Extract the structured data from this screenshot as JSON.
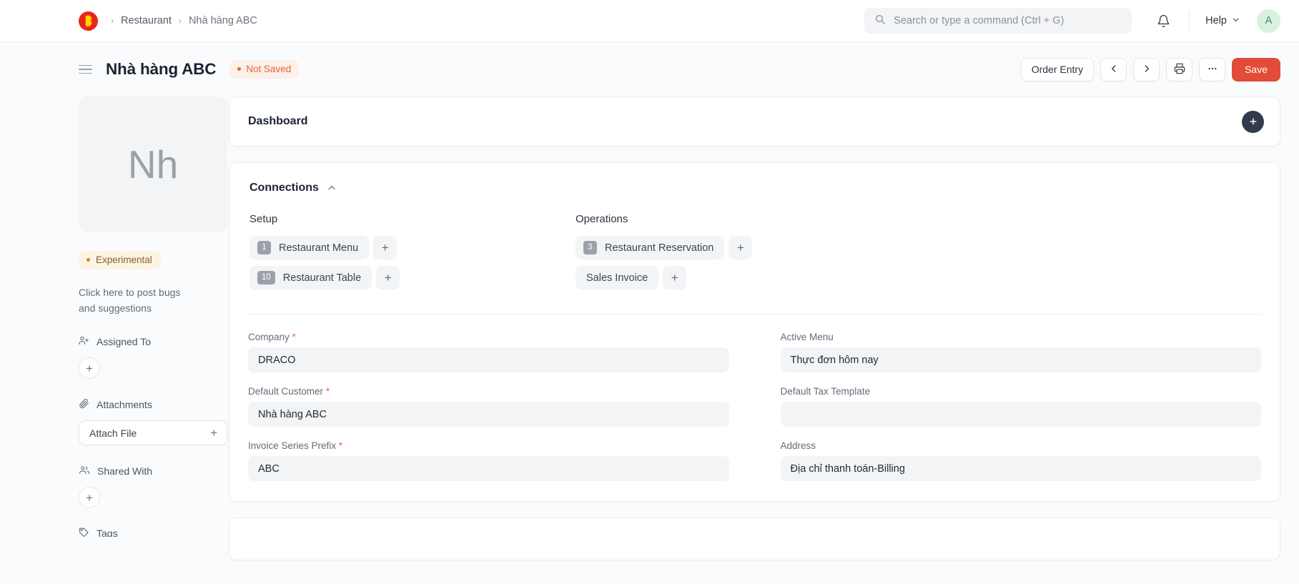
{
  "navbar": {
    "logo_icon": "draco-logo-icon",
    "breadcrumbs": [
      {
        "label": "Restaurant"
      },
      {
        "label": "Nhà hàng ABC"
      }
    ],
    "separator": "›",
    "search": {
      "icon": "search-icon",
      "placeholder": "Search or type a command (Ctrl + G)",
      "value": ""
    },
    "notifications_icon": "bell-icon",
    "help_label": "Help",
    "help_chevron": "chevron-down-icon",
    "avatar_initial": "A"
  },
  "page_head": {
    "menu_icon": "hamburger-icon",
    "title": "Nhà hàng ABC",
    "status_badge": "Not Saved",
    "actions": {
      "order_entry": "Order Entry",
      "prev_icon": "chevron-left-icon",
      "next_icon": "chevron-right-icon",
      "print_icon": "printer-icon",
      "more_icon": "ellipsis-icon",
      "more_label": "···",
      "save": "Save"
    }
  },
  "sidebar": {
    "avatar_text": "Nh",
    "experimental_badge": "Experimental",
    "note": "Click here to post bugs and suggestions",
    "sections": [
      {
        "label": "Assigned To",
        "icon": "user-plus-icon",
        "add_label": "+"
      },
      {
        "label": "Attachments",
        "icon": "paperclip-icon",
        "attach_label": "Attach File",
        "add_label": "+"
      },
      {
        "label": "Shared With",
        "icon": "users-icon",
        "add_label": "+"
      },
      {
        "label": "Tags",
        "icon": "tag-icon"
      }
    ]
  },
  "main": {
    "dashboard": {
      "title": "Dashboard",
      "add_icon": "plus-icon",
      "add_label": "+"
    },
    "connections": {
      "title": "Connections",
      "collapse_icon": "chevron-up-icon",
      "groups": [
        {
          "heading": "Setup",
          "items": [
            {
              "count": "1",
              "label": "Restaurant Menu",
              "add_label": "+"
            },
            {
              "count": "10",
              "label": "Restaurant Table",
              "add_label": "+"
            }
          ]
        },
        {
          "heading": "Operations",
          "items": [
            {
              "count": "3",
              "label": "Restaurant Reservation",
              "add_label": "+"
            },
            {
              "count": "",
              "label": "Sales Invoice",
              "add_label": "+"
            }
          ]
        }
      ]
    },
    "fields": {
      "left": [
        {
          "label": "Company",
          "required": true,
          "value": "DRACO",
          "placeholder": ""
        },
        {
          "label": "Default Customer",
          "required": true,
          "value": "Nhà hàng ABC",
          "placeholder": ""
        },
        {
          "label": "Invoice Series Prefix",
          "required": true,
          "value": "ABC",
          "placeholder": ""
        }
      ],
      "right": [
        {
          "label": "Active Menu",
          "required": false,
          "value": "Thực đơn hôm nay",
          "placeholder": ""
        },
        {
          "label": "Default Tax Template",
          "required": false,
          "value": "",
          "placeholder": ""
        },
        {
          "label": "Address",
          "required": false,
          "value": "Địa chỉ thanh toán-Billing",
          "placeholder": ""
        }
      ]
    }
  },
  "colors": {
    "accent_red": "#e24c38",
    "brand_red": "#e8251c",
    "dark": "#313b4c",
    "not_saved": "#e2663d",
    "experimental": "#8a6324",
    "avatar_green": "#2f9a53",
    "muted": "#636c79"
  }
}
